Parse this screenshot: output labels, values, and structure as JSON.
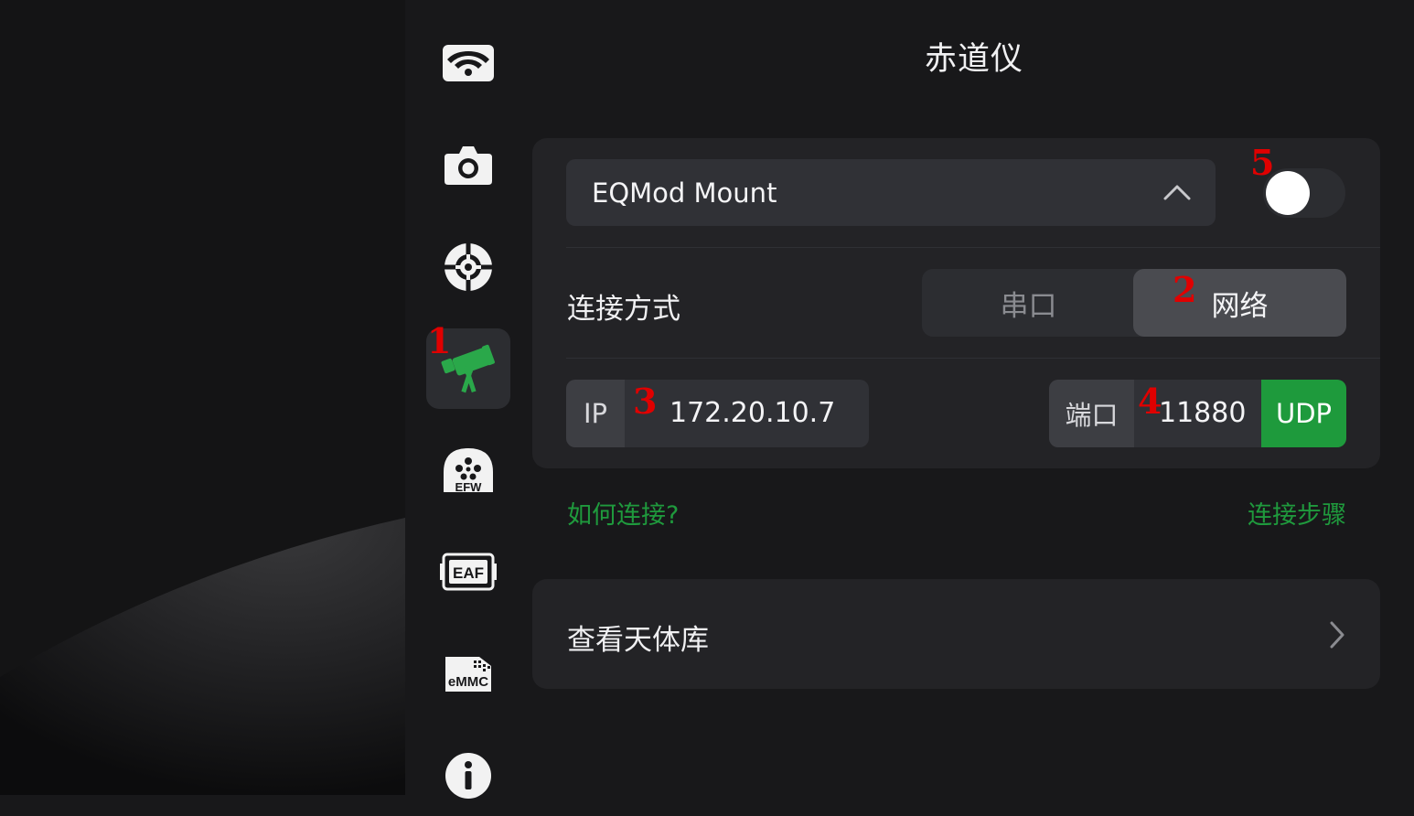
{
  "page": {
    "title": "赤道仪",
    "accent_color": "#1e9a3c"
  },
  "sidebar": {
    "items": [
      {
        "name": "wifi-icon",
        "active": false
      },
      {
        "name": "camera-icon",
        "active": false
      },
      {
        "name": "guide-crosshair-icon",
        "active": false
      },
      {
        "name": "telescope-icon",
        "active": true
      },
      {
        "name": "filter-wheel-icon",
        "label": "EFW",
        "active": false
      },
      {
        "name": "focuser-icon",
        "label": "EAF",
        "active": false
      },
      {
        "name": "storage-icon",
        "label": "eMMC",
        "active": false
      },
      {
        "name": "info-icon",
        "active": false
      }
    ]
  },
  "mount": {
    "selected": "EQMod Mount",
    "enabled": false,
    "connection_label": "连接方式",
    "connection_options": [
      "串口",
      "网络"
    ],
    "connection_selected": "网络",
    "ip_label": "IP",
    "ip_value": "172.20.10.7",
    "port_label": "端口",
    "port_value": "11880",
    "protocol": "UDP",
    "how_link": "如何连接?",
    "steps_link": "连接步骤"
  },
  "catalog": {
    "label": "查看天体库"
  },
  "annotations": [
    "1",
    "2",
    "3",
    "4",
    "5"
  ]
}
